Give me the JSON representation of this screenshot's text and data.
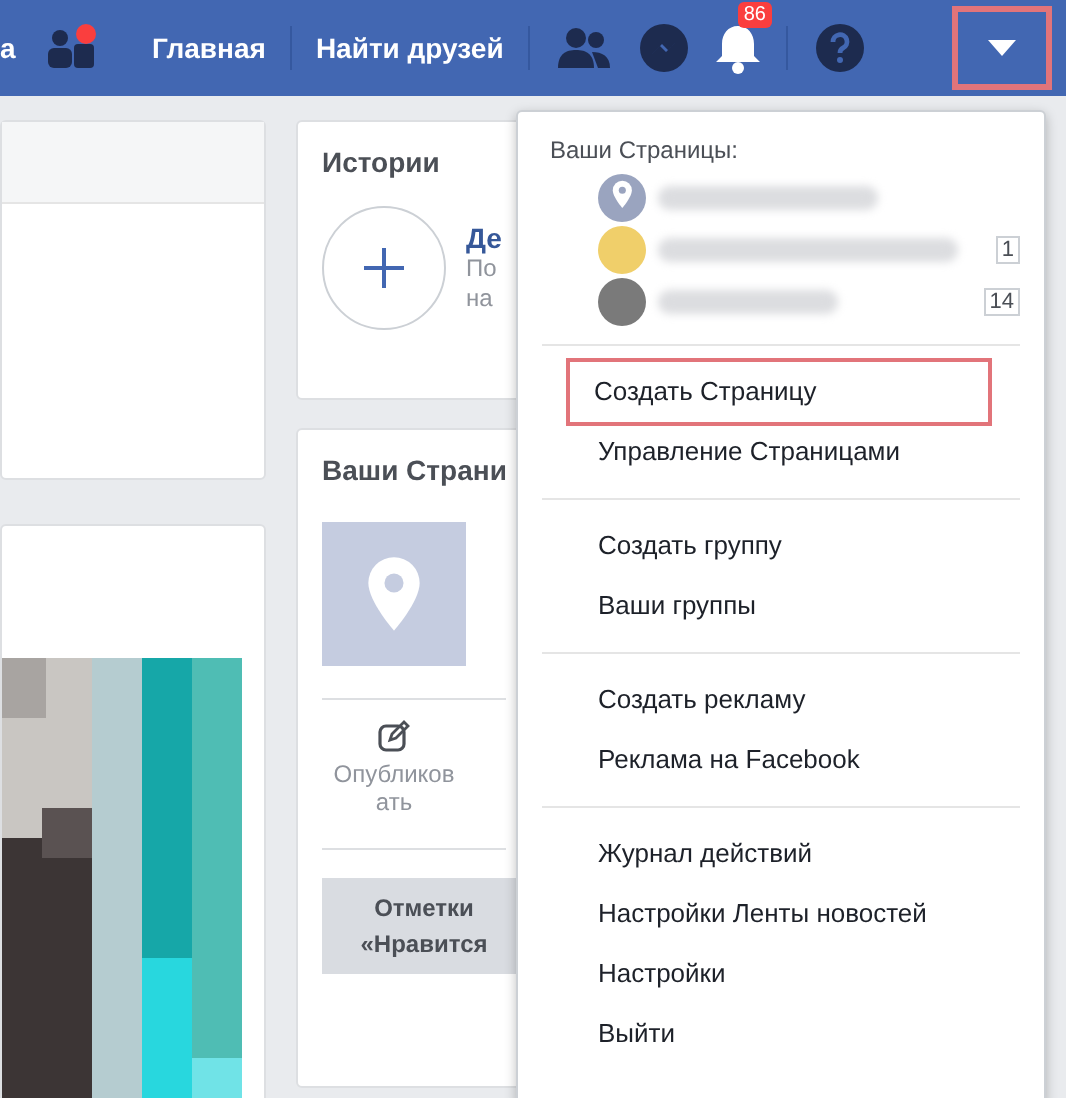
{
  "topbar": {
    "left_fragment": "а",
    "nav": [
      {
        "label": "Главная"
      },
      {
        "label": "Найти друзей"
      }
    ],
    "notifications_badge": "86",
    "menu_button_highlighted": true
  },
  "stories": {
    "title": "Истории",
    "add_title": "Де",
    "add_text_lines": [
      "По",
      "на"
    ]
  },
  "pages_card": {
    "title": "Ваши Страни",
    "publish": "Опубликов ать",
    "likes_lines": [
      "Отметки",
      "«Нравится"
    ]
  },
  "menu": {
    "heading": "Ваши Страницы:",
    "pages": [
      {
        "kind": "pin"
      },
      {
        "color": "#f0cf6a",
        "count": "1"
      },
      {
        "color": "#7a7a7a",
        "count": "14"
      }
    ],
    "sections": [
      [
        {
          "label": "Создать Страницу",
          "highlighted": true
        },
        {
          "label": "Управление Страницами",
          "highlighted": false
        }
      ],
      [
        {
          "label": "Создать группу",
          "highlighted": false
        },
        {
          "label": "Ваши группы",
          "highlighted": false
        }
      ],
      [
        {
          "label": "Создать рекламу",
          "highlighted": false
        },
        {
          "label": "Реклама на Facebook",
          "highlighted": false
        }
      ],
      [
        {
          "label": "Журнал действий",
          "highlighted": false
        },
        {
          "label": "Настройки Ленты новостей",
          "highlighted": false
        },
        {
          "label": "Настройки",
          "highlighted": false
        },
        {
          "label": "Выйти",
          "highlighted": false
        }
      ]
    ]
  }
}
